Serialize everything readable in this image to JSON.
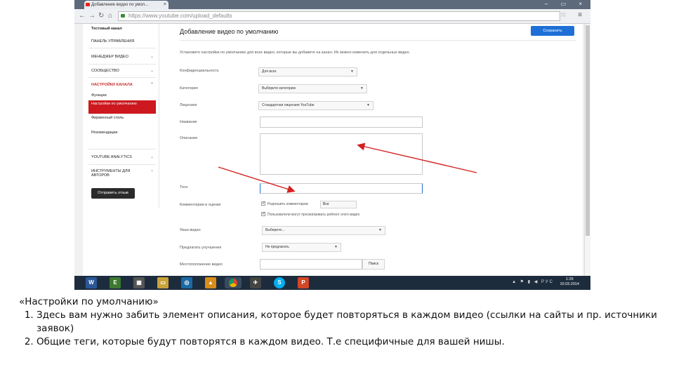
{
  "browser": {
    "tab_title": "Добавление видео по умол...",
    "tab_close": "×",
    "window_controls": "– ▭ ×",
    "url": "https://www.youtube.com/upload_defaults"
  },
  "sidebar": {
    "channel": "Тестовый канал",
    "items": [
      {
        "label": "ПАНЕЛЬ УПРАВЛЕНИЯ"
      },
      {
        "label": "МЕНЕДЖЕР ВИДЕО"
      },
      {
        "label": "СООБЩЕСТВО"
      },
      {
        "label": "НАСТРОЙКИ КАНАЛА"
      }
    ],
    "sub_items": [
      "Функции",
      "Настройки по умолчанию",
      "Фирменный стиль",
      "Рекомендации"
    ],
    "analytics": "YOUTUBE ANALYTICS",
    "tools": "ИНСТРУМЕНТЫ ДЛЯ АВТОРОВ",
    "create_button": "Отправить отзыв"
  },
  "main": {
    "title": "Добавление видео по умолчанию",
    "save_button": "Сохранить",
    "info": "Установите настройки по умолчанию для всех видео, которые вы добавите на канал. Их можно изменить для отдельных видео.",
    "fields": {
      "privacy_label": "Конфиденциальность",
      "privacy_value": "Для всех",
      "category_label": "Категория",
      "category_value": "Выберите категорию",
      "license_label": "Лицензия",
      "license_value": "Стандартная лицензия YouTube",
      "title_label": "Название",
      "description_label": "Описание",
      "tags_label": "Теги",
      "comments_label": "Комментарии и оценки",
      "allow_comments": "Разрешить комментарии",
      "comments_value": "Все",
      "users_can_view": "Пользователи могут просматривать рейтинг этого видео",
      "subtitles_label": "Язык видео",
      "subtitles_value": "Выберите...",
      "suggest_label": "Предлагать улучшения",
      "suggest_value": "Не предлагать",
      "location_label": "Местоположение видео",
      "location_button": "Поиск"
    }
  },
  "taskbar": {
    "tray_text": "▲ ⚑ ▮ ◀ РУС",
    "time": "1:29",
    "date": "10.03.2014"
  },
  "caption": {
    "heading": "«Настройки по умолчанию»",
    "points": [
      "Здесь вам нужно забить элемент описания, которое будет повторяться в каждом видео (ссылки на сайты и пр. источники заявок)",
      "Общие теги, которые будут повторятся в каждом видео. Т.е специфичные для вашей нишы."
    ]
  },
  "colors": {
    "accent_blue": "#1e6fd6",
    "active_red": "#cc181e",
    "arrow_red": "#d42020",
    "taskbar": "#1d2c3d"
  }
}
